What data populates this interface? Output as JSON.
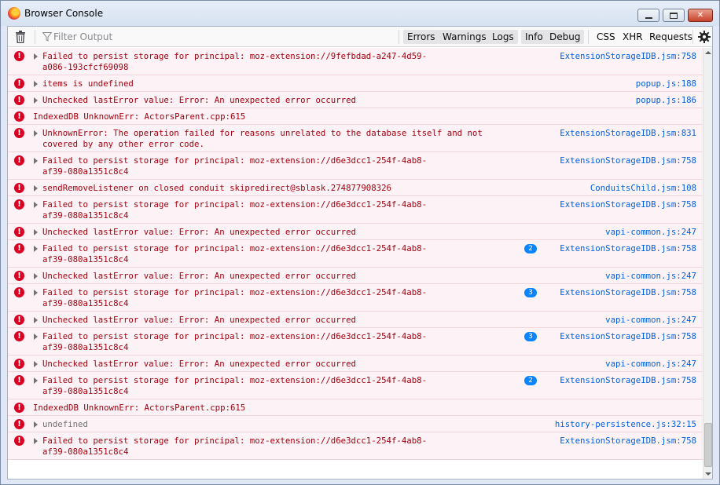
{
  "window": {
    "title": "Browser Console",
    "controls": {
      "minimize": "minimize",
      "maximize": "maximize",
      "close": "✕"
    }
  },
  "toolbar": {
    "filter_placeholder": "Filter Output",
    "filters": [
      "Errors",
      "Warnings",
      "Logs",
      "Info",
      "Debug"
    ],
    "extra": [
      "CSS",
      "XHR",
      "Requests"
    ]
  },
  "messages": [
    {
      "type": "error",
      "expandable": true,
      "lines": [
        "Failed to persist storage for principal: moz-extension://9fefbdad-a247-4d59-",
        "a086-193cfcf69098"
      ],
      "source": "ExtensionStorageIDB.jsm:758",
      "count": ""
    },
    {
      "type": "error",
      "expandable": true,
      "lines": [
        "items is undefined"
      ],
      "source": "popup.js:188",
      "count": ""
    },
    {
      "type": "error",
      "expandable": true,
      "lines": [
        "Unchecked lastError value: Error: An unexpected error occurred"
      ],
      "source": "popup.js:186",
      "count": ""
    },
    {
      "type": "error",
      "expandable": false,
      "lines": [
        "IndexedDB UnknownErr: ActorsParent.cpp:615"
      ],
      "source": "",
      "count": ""
    },
    {
      "type": "error",
      "expandable": true,
      "lines": [
        "UnknownError: The operation failed for reasons unrelated to the database itself and not",
        "covered by any other error code."
      ],
      "source": "ExtensionStorageIDB.jsm:831",
      "count": ""
    },
    {
      "type": "error",
      "expandable": true,
      "lines": [
        "Failed to persist storage for principal: moz-extension://d6e3dcc1-254f-4ab8-",
        "af39-080a1351c8c4"
      ],
      "source": "ExtensionStorageIDB.jsm:758",
      "count": ""
    },
    {
      "type": "error",
      "expandable": true,
      "lines": [
        "sendRemoveListener on closed conduit skipredirect@sblask.274877908326"
      ],
      "source": "ConduitsChild.jsm:108",
      "count": ""
    },
    {
      "type": "error",
      "expandable": true,
      "lines": [
        "Failed to persist storage for principal: moz-extension://d6e3dcc1-254f-4ab8-",
        "af39-080a1351c8c4"
      ],
      "source": "ExtensionStorageIDB.jsm:758",
      "count": ""
    },
    {
      "type": "error",
      "expandable": true,
      "lines": [
        "Unchecked lastError value: Error: An unexpected error occurred"
      ],
      "source": "vapi-common.js:247",
      "count": ""
    },
    {
      "type": "error",
      "expandable": true,
      "lines": [
        "Failed to persist storage for principal: moz-extension://d6e3dcc1-254f-4ab8-",
        "af39-080a1351c8c4"
      ],
      "source": "ExtensionStorageIDB.jsm:758",
      "count": "2"
    },
    {
      "type": "error",
      "expandable": true,
      "lines": [
        "Unchecked lastError value: Error: An unexpected error occurred"
      ],
      "source": "vapi-common.js:247",
      "count": ""
    },
    {
      "type": "error",
      "expandable": true,
      "lines": [
        "Failed to persist storage for principal: moz-extension://d6e3dcc1-254f-4ab8-",
        "af39-080a1351c8c4"
      ],
      "source": "ExtensionStorageIDB.jsm:758",
      "count": "3"
    },
    {
      "type": "error",
      "expandable": true,
      "lines": [
        "Unchecked lastError value: Error: An unexpected error occurred"
      ],
      "source": "vapi-common.js:247",
      "count": ""
    },
    {
      "type": "error",
      "expandable": true,
      "lines": [
        "Failed to persist storage for principal: moz-extension://d6e3dcc1-254f-4ab8-",
        "af39-080a1351c8c4"
      ],
      "source": "ExtensionStorageIDB.jsm:758",
      "count": "3"
    },
    {
      "type": "error",
      "expandable": true,
      "lines": [
        "Unchecked lastError value: Error: An unexpected error occurred"
      ],
      "source": "vapi-common.js:247",
      "count": ""
    },
    {
      "type": "error",
      "expandable": true,
      "lines": [
        "Failed to persist storage for principal: moz-extension://d6e3dcc1-254f-4ab8-",
        "af39-080a1351c8c4"
      ],
      "source": "ExtensionStorageIDB.jsm:758",
      "count": "2"
    },
    {
      "type": "error",
      "expandable": false,
      "lines": [
        "IndexedDB UnknownErr: ActorsParent.cpp:615"
      ],
      "source": "",
      "count": ""
    },
    {
      "type": "error",
      "expandable": true,
      "lines": [
        "undefined"
      ],
      "source": "history-persistence.js:32:15",
      "count": "",
      "muted": true
    },
    {
      "type": "error",
      "expandable": true,
      "lines": [
        "Failed to persist storage for principal: moz-extension://d6e3dcc1-254f-4ab8-",
        "af39-080a1351c8c4"
      ],
      "source": "ExtensionStorageIDB.jsm:758",
      "count": ""
    }
  ],
  "colors": {
    "error_text": "#a4000f",
    "error_bg": "#fdf2f5",
    "source_link": "#0060df",
    "badge": "#0a84ff"
  }
}
